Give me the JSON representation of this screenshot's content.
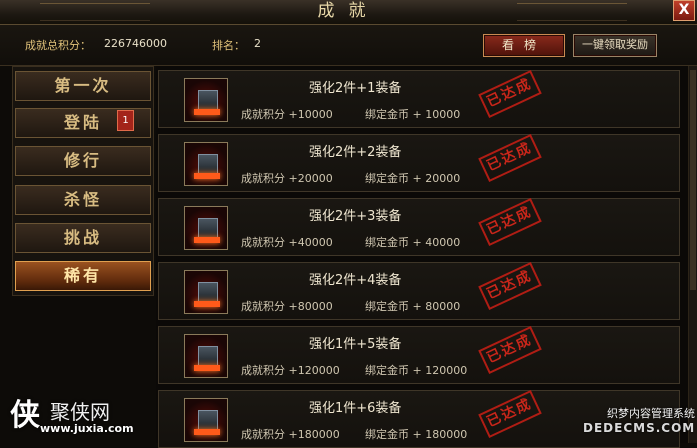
{
  "window": {
    "title": "成就",
    "close_label": "X"
  },
  "header": {
    "score_label": "成就总积分：",
    "score_value": "226746000",
    "rank_label": "排名：",
    "rank_value": "2",
    "view_button": "看榜",
    "claim_button": "一键领取奖励"
  },
  "sidebar": {
    "tabs": [
      {
        "label": "第一次"
      },
      {
        "label": "登陆",
        "badge": "1"
      },
      {
        "label": "修行"
      },
      {
        "label": "杀怪"
      },
      {
        "label": "挑战"
      },
      {
        "label": "稀有"
      }
    ],
    "active_tab": "稀有"
  },
  "achievements": [
    {
      "title": "强化2件+1装备",
      "score": "成就积分 +10000",
      "gold": "绑定金币 + 10000",
      "status": "已达成"
    },
    {
      "title": "强化2件+2装备",
      "score": "成就积分 +20000",
      "gold": "绑定金币 + 20000",
      "status": "已达成"
    },
    {
      "title": "强化2件+3装备",
      "score": "成就积分 +40000",
      "gold": "绑定金币 + 40000",
      "status": "已达成"
    },
    {
      "title": "强化2件+4装备",
      "score": "成就积分 +80000",
      "gold": "绑定金币 + 80000",
      "status": "已达成"
    },
    {
      "title": "强化1件+5装备",
      "score": "成就积分 +120000",
      "gold": "绑定金币 + 120000",
      "status": "已达成"
    },
    {
      "title": "强化1件+6装备",
      "score": "成就积分 +180000",
      "gold": "绑定金币 + 180000",
      "status": "已达成"
    }
  ],
  "watermarks": {
    "left_logo": "侠",
    "left_name": "聚侠网",
    "left_url": "www.juxia.com",
    "right_line1": "织梦内容管理系统",
    "right_line2": "DEDECMS.COM"
  },
  "icons": {
    "item": "anvil-icon",
    "close": "close-icon"
  },
  "colors": {
    "accent_red": "#b01d14",
    "gold_text": "#e0c27a",
    "active_tab": "#9a5220"
  }
}
